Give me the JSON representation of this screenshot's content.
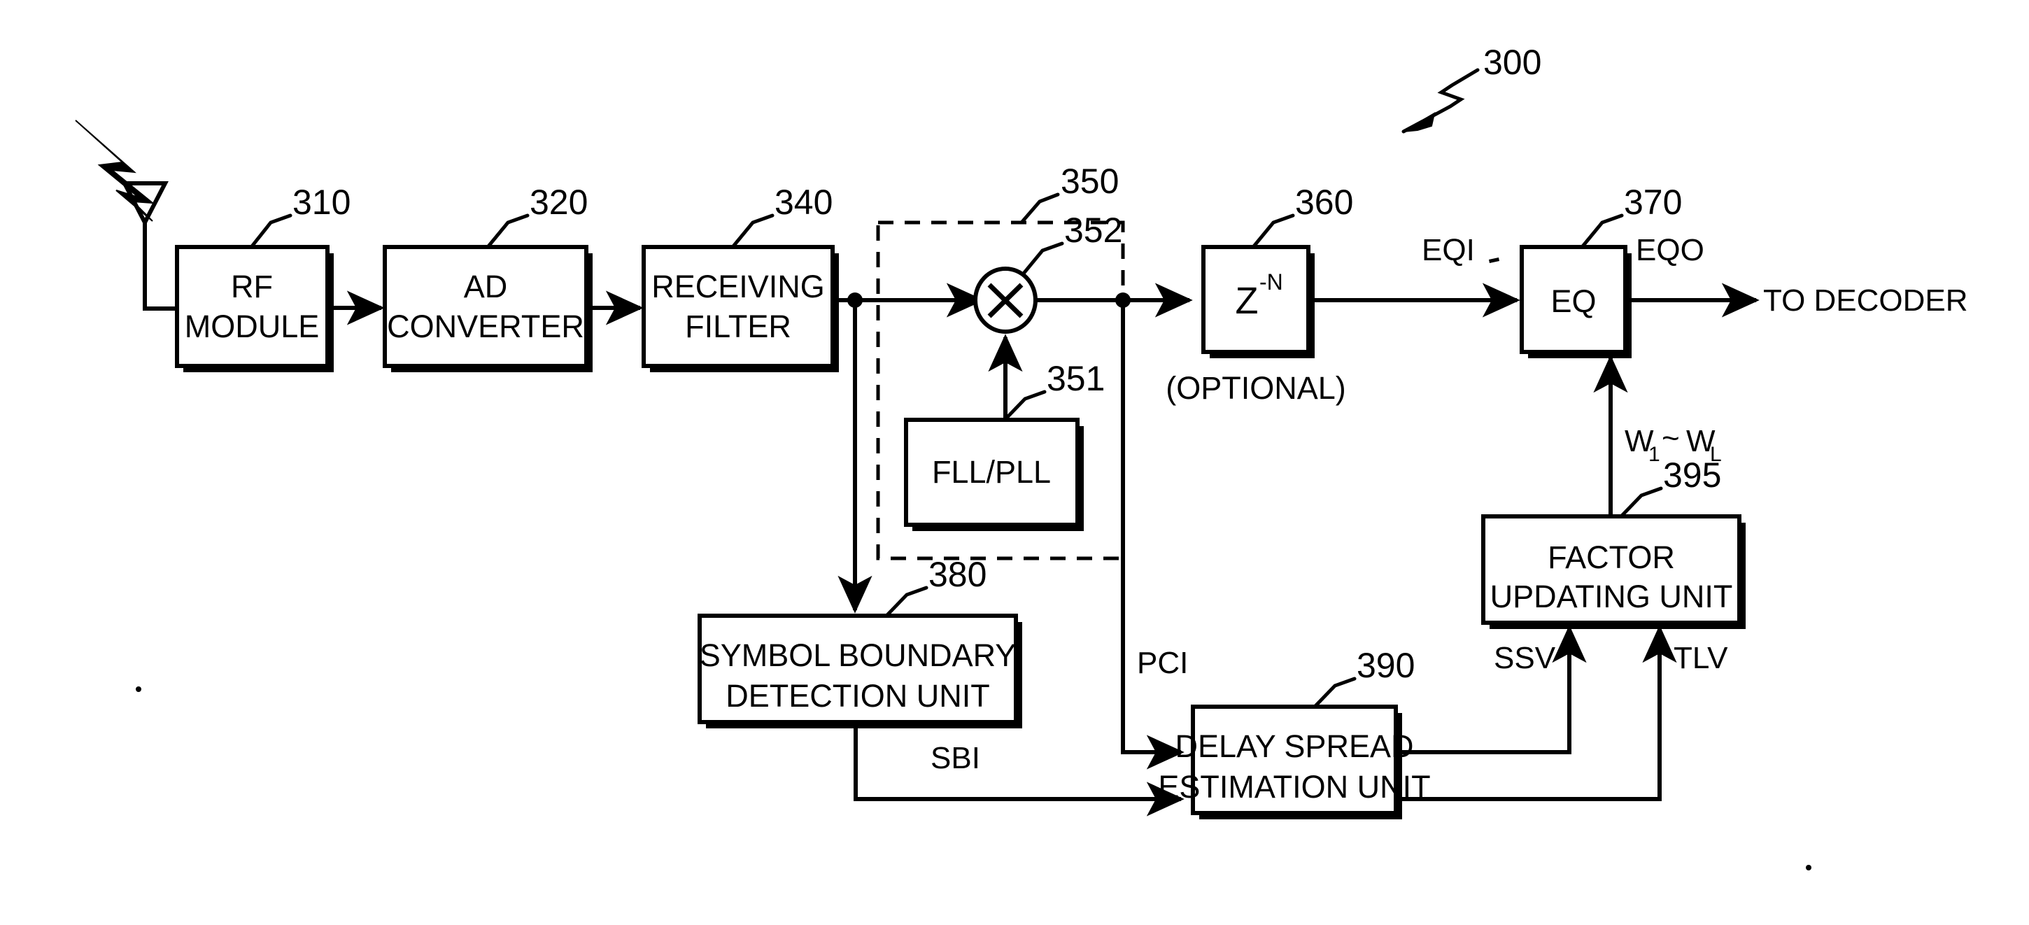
{
  "figure": {
    "reference_label": "300",
    "blocks": [
      {
        "id": "rf_module",
        "ref": "310",
        "lines": [
          "RF",
          "MODULE"
        ]
      },
      {
        "id": "ad_converter",
        "ref": "320",
        "lines": [
          "AD",
          "CONVERTER"
        ]
      },
      {
        "id": "rx_filter",
        "ref": "340",
        "lines": [
          "RECEIVING",
          "FILTER"
        ]
      },
      {
        "id": "fll_pll",
        "ref": "351",
        "lines": [
          "FLL/PLL"
        ]
      },
      {
        "id": "mixer",
        "ref": "352",
        "lines": [
          "×"
        ]
      },
      {
        "id": "delay",
        "ref": "360",
        "lines": [
          "Z"
        ],
        "superscript": "-N",
        "note": "(OPTIONAL)"
      },
      {
        "id": "equalizer",
        "ref": "370",
        "lines": [
          "EQ"
        ]
      },
      {
        "id": "symbol_boundary",
        "ref": "380",
        "lines": [
          "SYMBOL BOUNDARY",
          "DETECTION UNIT"
        ]
      },
      {
        "id": "delay_spread",
        "ref": "390",
        "lines": [
          "DELAY SPREAD",
          "ESTIMATION UNIT"
        ]
      },
      {
        "id": "factor_updating",
        "ref": "395",
        "lines": [
          "FACTOR",
          "UPDATING UNIT"
        ]
      }
    ],
    "dashed_group": {
      "ref": "350"
    },
    "signals": [
      {
        "id": "eqi",
        "label": "EQI"
      },
      {
        "id": "eqo",
        "label": "EQO"
      },
      {
        "id": "to_decoder",
        "label": "TO DECODER"
      },
      {
        "id": "pci",
        "label": "PCI"
      },
      {
        "id": "sbi",
        "label": "SBI"
      },
      {
        "id": "ssv",
        "label": "SSV"
      },
      {
        "id": "tlv",
        "label": "TLV"
      },
      {
        "id": "weights",
        "label": "W",
        "sub1": "1",
        "tilde": "~",
        "label2": "W",
        "sub2": "L"
      }
    ],
    "refs": {
      "r300": "300",
      "r310": "310",
      "r320": "320",
      "r340": "340",
      "r350": "350",
      "r351": "351",
      "r352": "352",
      "r360": "360",
      "r370": "370",
      "r380": "380",
      "r390": "390",
      "r395": "395"
    },
    "text": {
      "rf_l1": "RF",
      "rf_l2": "MODULE",
      "ad_l1": "AD",
      "ad_l2": "CONVERTER",
      "rx_l1": "RECEIVING",
      "rx_l2": "FILTER",
      "fll": "FLL/PLL",
      "z": "Z",
      "z_sup": "-N",
      "optional": "(OPTIONAL)",
      "eq": "EQ",
      "sbd_l1": "SYMBOL BOUNDARY",
      "sbd_l2": "DETECTION UNIT",
      "dse_l1": "DELAY SPREAD",
      "dse_l2": "ESTIMATION UNIT",
      "fuu_l1": "FACTOR",
      "fuu_l2": "UPDATING UNIT",
      "eqi": "EQI",
      "eqo": "EQO",
      "to_decoder": "TO DECODER",
      "pci": "PCI",
      "sbi": "SBI",
      "ssv": "SSV",
      "tlv": "TLV",
      "w_main": "W",
      "w_sub1": "1",
      "w_tilde": "~",
      "w_main2": "W",
      "w_sub2": "L",
      "mult": "×"
    },
    "colors": {
      "ink": "#000000",
      "paper": "#ffffff"
    }
  }
}
